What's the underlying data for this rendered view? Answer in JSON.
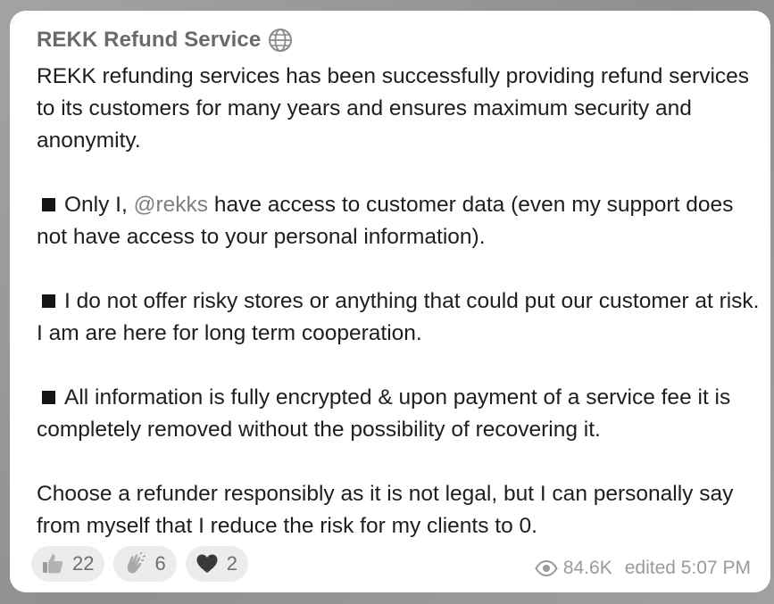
{
  "message": {
    "channel_name": "REKK Refund Service",
    "paragraphs": {
      "intro": "REKK refunding services has been successfully providing refund services to its customers for many years and ensures maximum security and anonymity.",
      "p1_before": "Only I, ",
      "p1_mention": "@rekks",
      "p1_after": " have access to customer data (even my support does not have access to your personal information).",
      "p2": "I do not offer risky stores or anything that could put our customer at risk. I am are here for long term cooperation.",
      "p3": "All information is fully encrypted & upon payment of a service fee it is completely removed without the possibility of recovering it.",
      "closing": "Choose a refunder responsibly as it is not legal,  but I can personally say from myself that I reduce the risk for my clients to 0."
    },
    "reactions": [
      {
        "icon": "thumbs-up-icon",
        "count": "22"
      },
      {
        "icon": "clapping-hands-icon",
        "count": "6"
      },
      {
        "icon": "heart-icon",
        "count": "2"
      }
    ],
    "views": "84.6K",
    "edited_label": "edited",
    "time": "5:07 PM"
  }
}
